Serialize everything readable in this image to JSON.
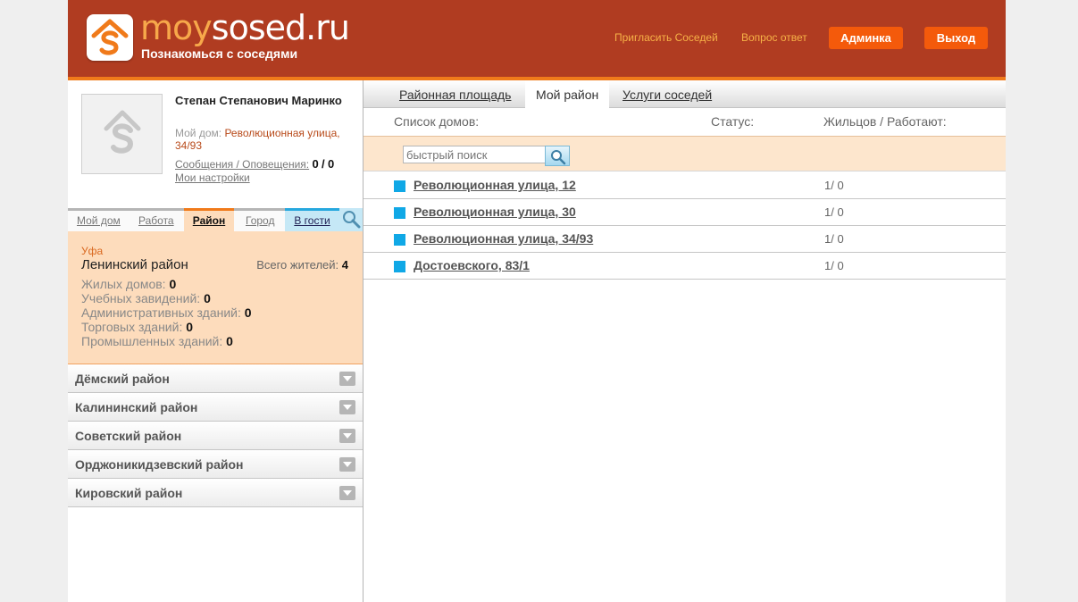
{
  "header": {
    "logo_moy": "moy",
    "logo_rest": "sosed.ru",
    "tagline": "Познакомься с соседями",
    "invite": "Пригласить Соседей",
    "faq": "Вопрос ответ",
    "admin": "Админка",
    "logout": "Выход"
  },
  "profile": {
    "name": "Степан Степанович Маринко",
    "my_home_label": "Мой дом:",
    "my_home_addr": "Революционная улица, 34/93",
    "messages_label": "Сообщения / Оповещения:",
    "messages_count": "0",
    "sep": "/",
    "alerts_count": "0",
    "settings": "Мои настройки"
  },
  "left_tabs": [
    "Мой дом",
    "Работа",
    "Район",
    "Город",
    "В гости"
  ],
  "district_info": {
    "city": "Уфа",
    "district": "Ленинский район",
    "total_label": "Всего жителей:",
    "total": "4",
    "stats": [
      {
        "label": "Жилых домов:",
        "value": "0"
      },
      {
        "label": "Учебных завидений:",
        "value": "0"
      },
      {
        "label": "Административных зданий:",
        "value": "0"
      },
      {
        "label": "Торговых зданий:",
        "value": "0"
      },
      {
        "label": "Промышленных зданий:",
        "value": "0"
      }
    ]
  },
  "districts": [
    "Дёмский район",
    "Калининский район",
    "Советский район",
    "Орджоникидзевский район",
    "Кировский район"
  ],
  "right_tabs": [
    "Районная площадь",
    "Мой район",
    "Услуги соседей"
  ],
  "columns": {
    "houses": "Список домов:",
    "status": "Статус:",
    "residents": "Жильцов / Работают:"
  },
  "search": {
    "placeholder": "быстрый поиск"
  },
  "houses": [
    {
      "name": "Революционная улица, 12",
      "count": "1/ 0"
    },
    {
      "name": "Революционная улица, 30",
      "count": "1/ 0"
    },
    {
      "name": "Революционная улица, 34/93",
      "count": "1/ 0"
    },
    {
      "name": "Достоевского, 83/1",
      "count": "1/ 0"
    }
  ],
  "colors": {
    "header": "#b03c21",
    "accent": "#f45a0b",
    "highlight": "#fddcbc",
    "square": "#10a8e6"
  }
}
